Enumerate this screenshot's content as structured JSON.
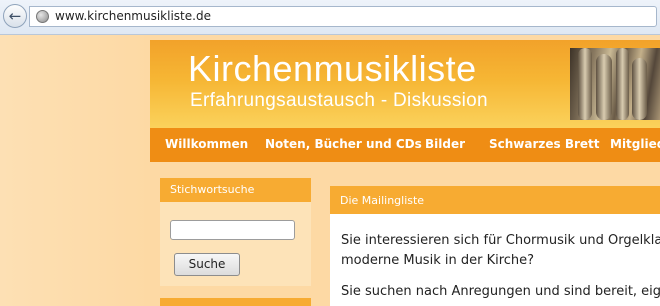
{
  "browser": {
    "url": "www.kirchenmusikliste.de",
    "back_icon": "back-arrow-icon",
    "site_icon": "globe-icon"
  },
  "header": {
    "title": "Kirchenmusikliste",
    "subtitle": "Erfahrungsaustausch - Diskussion"
  },
  "nav": {
    "items": [
      {
        "label": "Willkommen"
      },
      {
        "label": "Noten, Bücher und CDs"
      },
      {
        "label": "Bilder"
      },
      {
        "label": "Schwarzes Brett"
      },
      {
        "label": "Mitglieder"
      }
    ]
  },
  "sidebar": {
    "search_heading": "Stichwortsuche",
    "search_value": "",
    "search_button": "Suche"
  },
  "main": {
    "heading": "Die Mailingliste",
    "line1": "Sie interessieren sich für Chormusik und Orgelklang",
    "line2": "moderne Musik in der Kirche?",
    "line3": "Sie suchen nach Anregungen und sind bereit, eigene"
  },
  "colors": {
    "accent": "#ef8d14",
    "box_header": "#f7ab32",
    "banner": "#f6b634"
  }
}
